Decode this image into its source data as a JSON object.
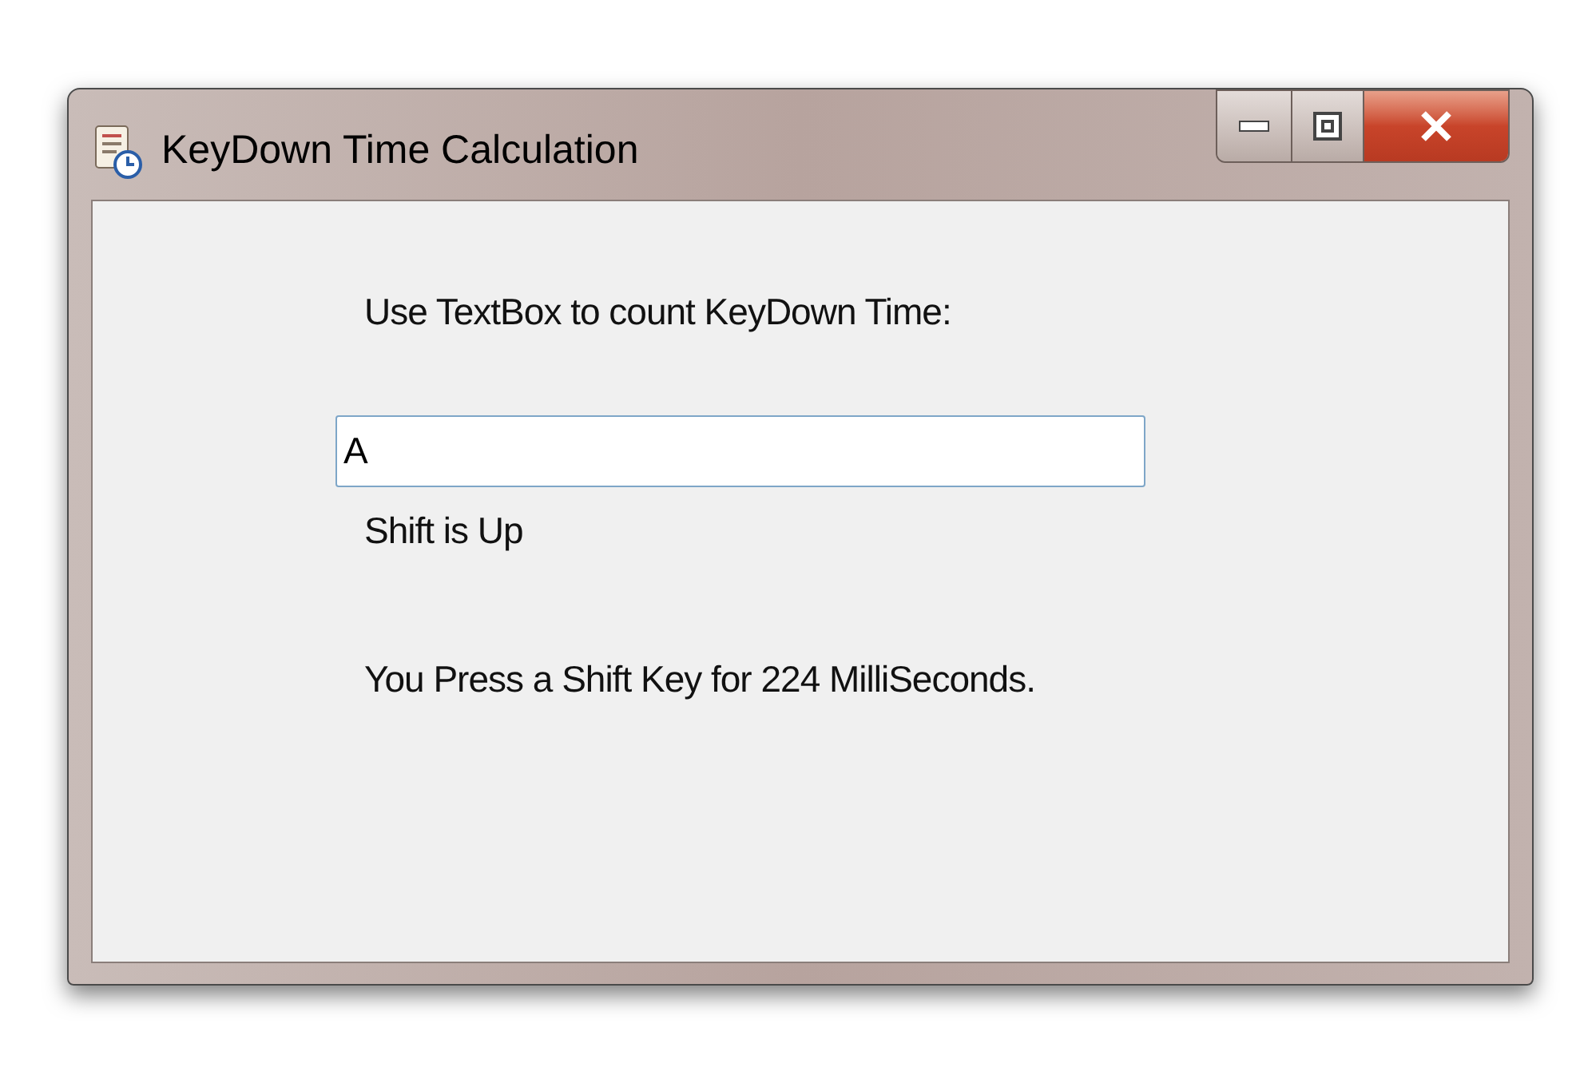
{
  "window": {
    "title": "KeyDown Time Calculation"
  },
  "prompt": "Use TextBox to count KeyDown Time:",
  "textbox": {
    "value": "A"
  },
  "shift_status": "Shift is Up",
  "result": "You Press a Shift Key for 224 MilliSeconds."
}
